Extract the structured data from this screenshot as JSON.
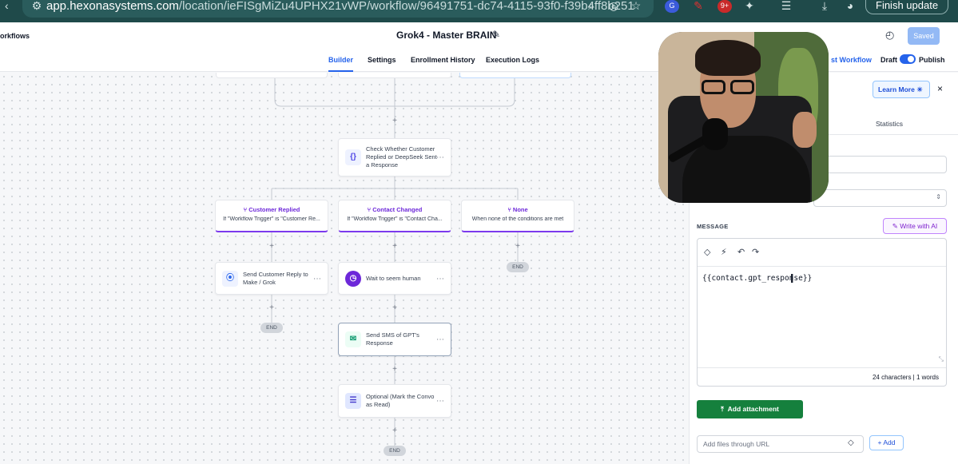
{
  "browser": {
    "url_host": "app.hexonasystems.com",
    "url_path": "/location/ieFISgMiZu4UPHX21vWP/workflow/96491751-dc74-4115-93f0-f39b4ff8b251",
    "ext_badge": "9+",
    "finish_update": "Finish update"
  },
  "header": {
    "back_label": "orkflows",
    "title": "Grok4 - Master BRAIN",
    "saved_label": "Saved",
    "tabs": [
      "Builder",
      "Settings",
      "Enrollment History",
      "Execution Logs"
    ],
    "test_workflow": "st Workflow",
    "draft_label": "Draft",
    "publish_label": "Publish"
  },
  "canvas": {
    "condition_node": "Check Whether Customer Replied or DeepSeek Sent a Response",
    "branches": [
      {
        "title": "Customer Replied",
        "sub": "If \"Workflow Trigger\" is \"Customer Re..."
      },
      {
        "title": "Contact Changed",
        "sub": "If \"Workflow Trigger\" is \"Contact Cha..."
      },
      {
        "title": "None",
        "sub": "When none of the conditions are met"
      }
    ],
    "send_reply_node": "Send Customer Reply to Make / Grok",
    "wait_node": "Wait to seem human",
    "sms_node": "Send SMS of GPT's Response",
    "optional_node": "Optional (Mark the Convo as Read)",
    "end_label": "END",
    "plus": "+",
    "menu": "···"
  },
  "panel": {
    "learn_more": "Learn More",
    "close": "×",
    "statistics_tab": "Statistics",
    "message_label": "MESSAGE",
    "write_ai": "Write with AI",
    "message_body": "{{contact.gpt_response}}",
    "char_count": "24 characters | 1 words",
    "add_attachment": "Add attachment",
    "url_placeholder": "Add files through URL",
    "add_button": "+ Add"
  },
  "colors": {
    "chrome": "#1f4a4a",
    "primary_blue": "#2563eb",
    "branch_purple": "#7c3aed",
    "attach_green": "#15803d"
  }
}
